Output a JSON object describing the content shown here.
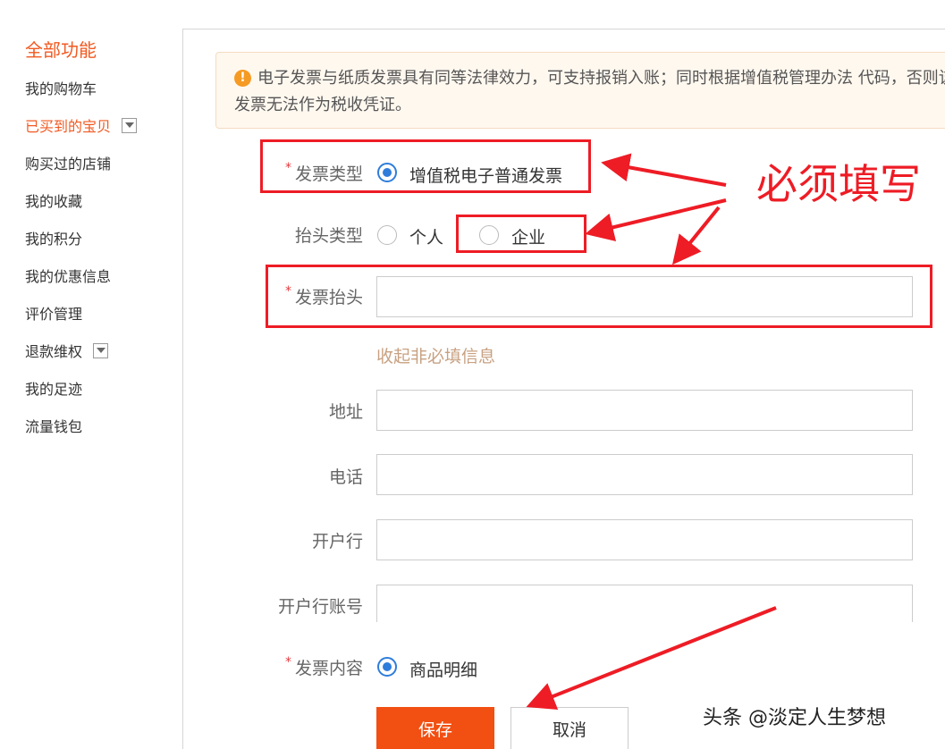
{
  "sidebar": {
    "title": "全部功能",
    "items": [
      {
        "label": "我的购物车"
      },
      {
        "label": "已买到的宝贝"
      },
      {
        "label": "购买过的店铺"
      },
      {
        "label": "我的收藏"
      },
      {
        "label": "我的积分"
      },
      {
        "label": "我的优惠信息"
      },
      {
        "label": "评价管理"
      },
      {
        "label": "退款维权"
      },
      {
        "label": "我的足迹"
      },
      {
        "label": "流量钱包"
      }
    ]
  },
  "notice": {
    "text": "电子发票与纸质发票具有同等法律效力，可支持报销入账；同时根据增值税管理办法 代码，否则该发票无法作为税收凭证。"
  },
  "form": {
    "invoice_type": {
      "label": "发票类型",
      "option": "增值税电子普通发票"
    },
    "title_type": {
      "label": "抬头类型",
      "option_personal": "个人",
      "option_company": "企业"
    },
    "invoice_title": {
      "label": "发票抬头",
      "value": ""
    },
    "collapse_link": "收起非必填信息",
    "address": {
      "label": "地址",
      "value": ""
    },
    "phone": {
      "label": "电话",
      "value": ""
    },
    "bank": {
      "label": "开户行",
      "value": ""
    },
    "bank_account": {
      "label": "开户行账号",
      "value": ""
    },
    "invoice_content": {
      "label": "发票内容",
      "option": "商品明细"
    },
    "required_mark": "*",
    "save_label": "保存",
    "cancel_label": "取消"
  },
  "annotation": {
    "text": "必须填写",
    "color": "#ee1c25"
  },
  "watermark": {
    "text": "头条 @淡定人生梦想"
  },
  "colors": {
    "accent": "#f15a22",
    "radio": "#2e7ddb",
    "save_button": "#f24f12"
  }
}
